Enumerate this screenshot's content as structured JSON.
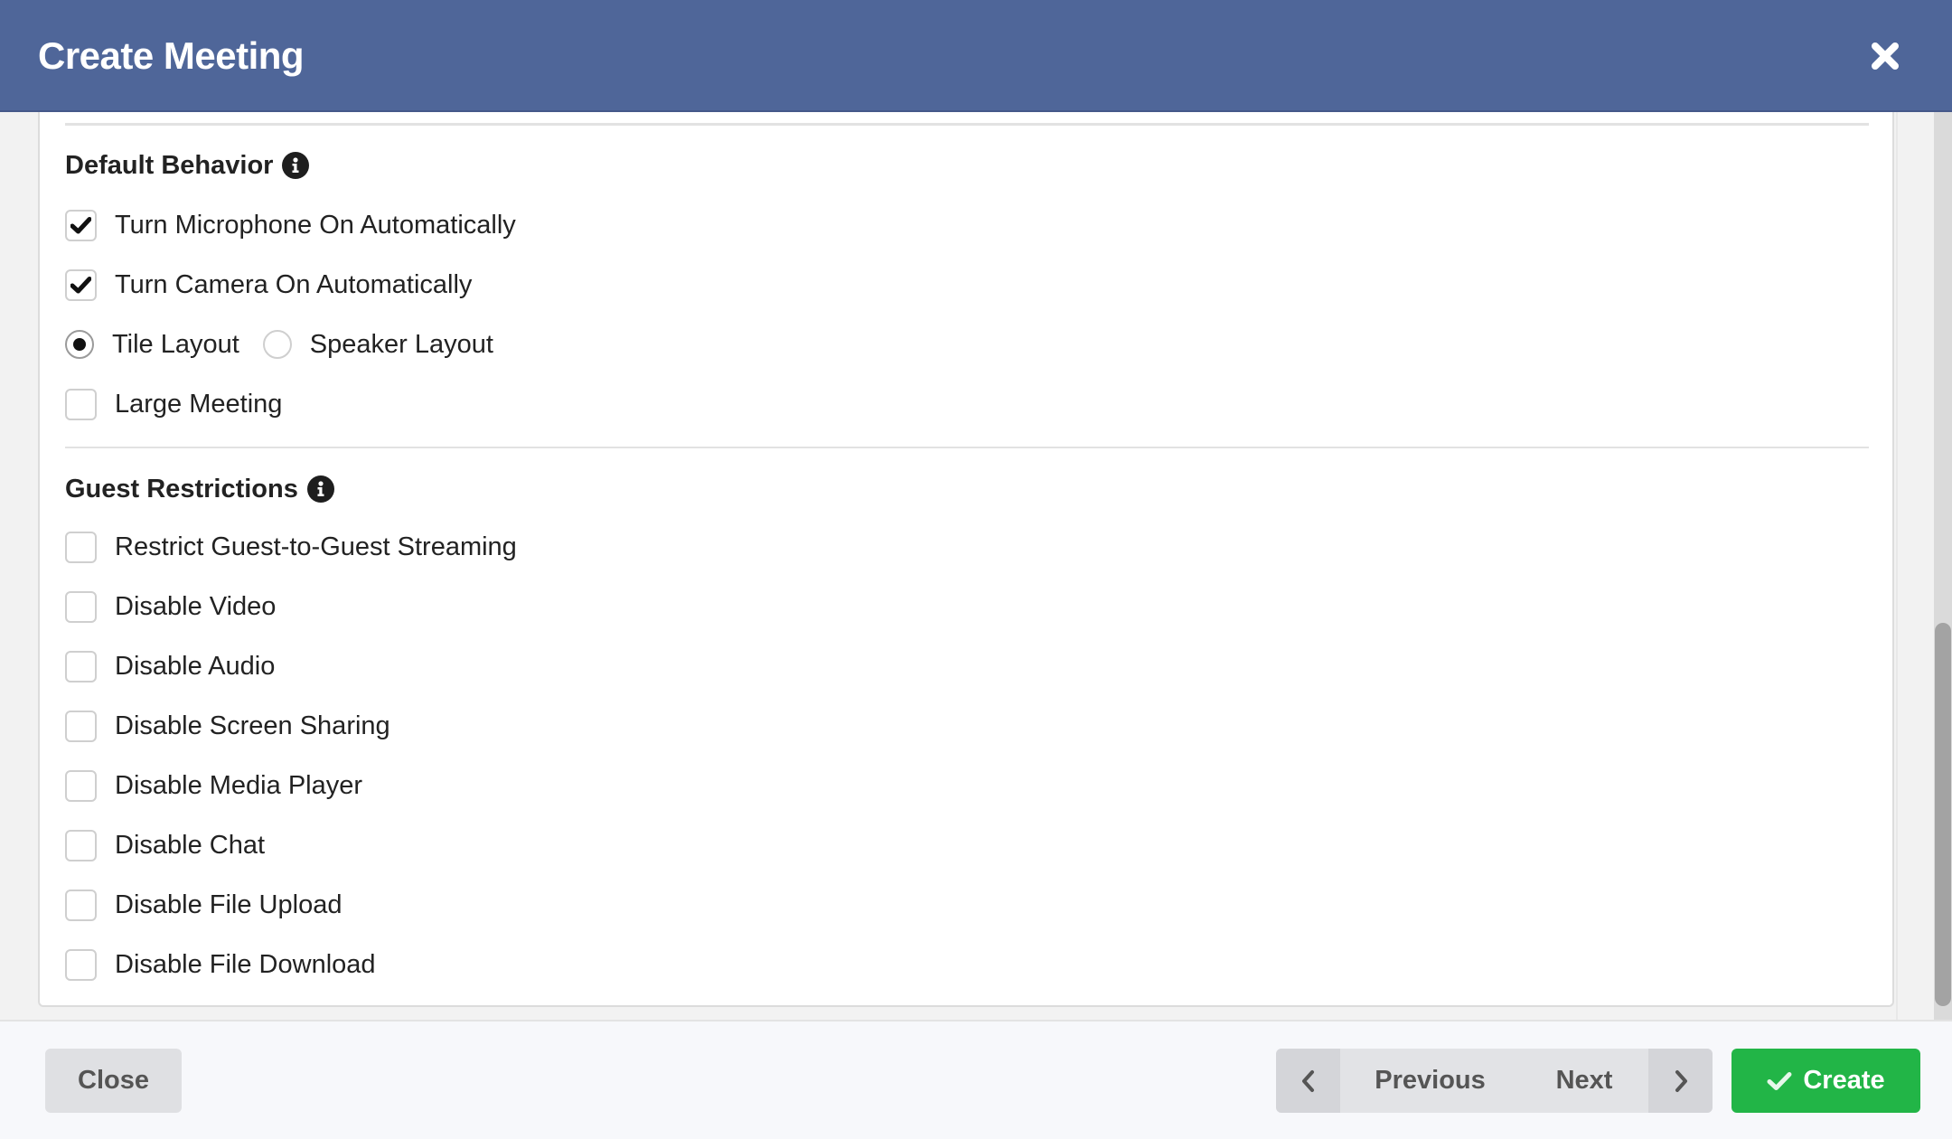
{
  "dialog": {
    "title": "Create Meeting",
    "close_icon": "close-x-icon"
  },
  "default_behavior": {
    "title": "Default Behavior",
    "info_icon": "info-circle-icon",
    "options": [
      {
        "label": "Turn Microphone On Automatically",
        "type": "checkbox",
        "checked": true
      },
      {
        "label": "Turn Camera On Automatically",
        "type": "checkbox",
        "checked": true
      }
    ],
    "layout": {
      "options": [
        {
          "label": "Tile Layout",
          "selected": true
        },
        {
          "label": "Speaker Layout",
          "selected": false
        }
      ]
    },
    "large_meeting": {
      "label": "Large Meeting",
      "type": "checkbox",
      "checked": false
    }
  },
  "guest_restrictions": {
    "title": "Guest Restrictions",
    "info_icon": "info-circle-icon",
    "options": [
      {
        "label": "Restrict Guest-to-Guest Streaming",
        "checked": false
      },
      {
        "label": "Disable Video",
        "checked": false
      },
      {
        "label": "Disable Audio",
        "checked": false
      },
      {
        "label": "Disable Screen Sharing",
        "checked": false
      },
      {
        "label": "Disable Media Player",
        "checked": false
      },
      {
        "label": "Disable Chat",
        "checked": false
      },
      {
        "label": "Disable File Upload",
        "checked": false
      },
      {
        "label": "Disable File Download",
        "checked": false
      }
    ]
  },
  "footer": {
    "close_label": "Close",
    "previous_label": "Previous",
    "next_label": "Next",
    "create_label": "Create",
    "create_icon": "check-icon",
    "prev_icon": "chevron-left-icon",
    "next_icon": "chevron-right-icon"
  },
  "colors": {
    "header": "#4f6699",
    "create_button": "#22b547",
    "neutral_button": "#dfe0e3"
  }
}
